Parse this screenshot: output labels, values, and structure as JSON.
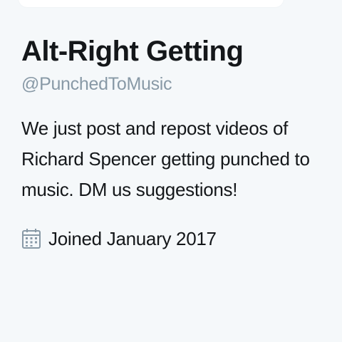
{
  "profile": {
    "display_name": "Alt-Right Getting",
    "handle": "@PunchedToMusic",
    "bio_lines": [
      "We just post and repost videos of",
      "Richard Spencer getting punched to",
      "music. DM us suggestions!"
    ],
    "joined": "Joined January 2017",
    "joined_icon": "calendar-icon"
  },
  "colors": {
    "background": "#f5f8fa",
    "text": "#14171a",
    "muted": "#8899a6"
  }
}
